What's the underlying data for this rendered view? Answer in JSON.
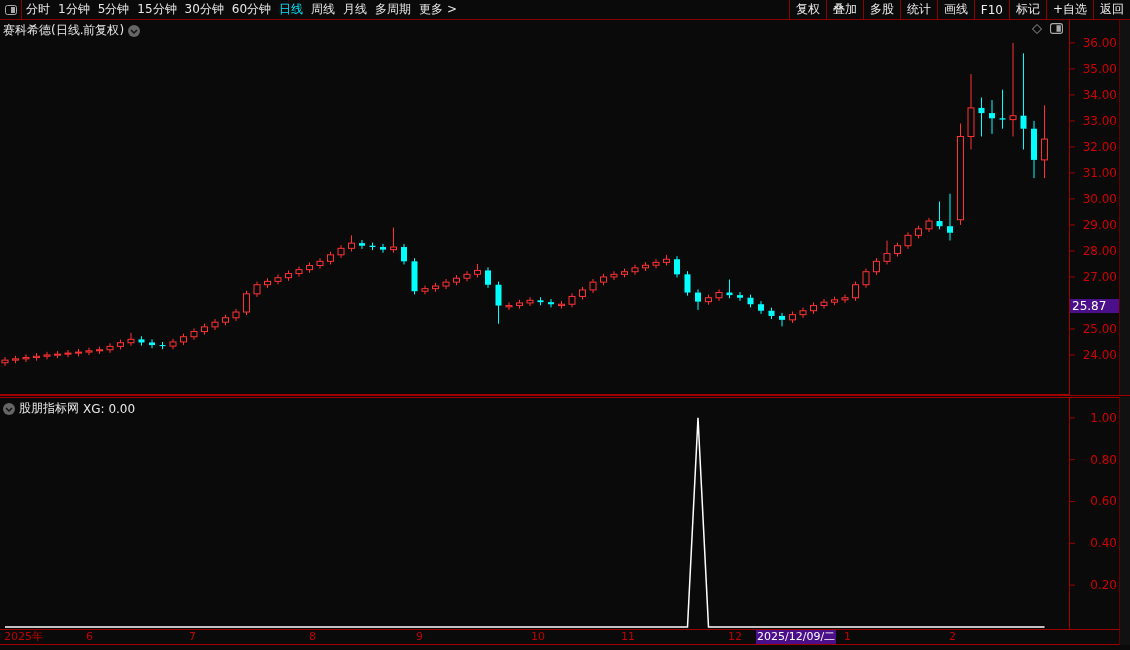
{
  "toolbar": {
    "periods": [
      {
        "label": "分时",
        "selected": false
      },
      {
        "label": "1分钟",
        "selected": false
      },
      {
        "label": "5分钟",
        "selected": false
      },
      {
        "label": "15分钟",
        "selected": false
      },
      {
        "label": "30分钟",
        "selected": false
      },
      {
        "label": "60分钟",
        "selected": false
      },
      {
        "label": "日线",
        "selected": true
      },
      {
        "label": "周线",
        "selected": false
      },
      {
        "label": "月线",
        "selected": false
      },
      {
        "label": "多周期",
        "selected": false
      }
    ],
    "more": "更多 >",
    "actions": [
      "复权",
      "叠加",
      "多股",
      "统计",
      "画线",
      "F10",
      "标记",
      "+自选",
      "返回"
    ]
  },
  "price_chart": {
    "title": "赛科希德(日线.前复权)",
    "last_price": "25.87",
    "chart_data": {
      "type": "candlestick",
      "ylim": [
        22.46,
        36.88
      ],
      "yticks": [
        {
          "value": 36,
          "label": "36.00"
        },
        {
          "value": 35,
          "label": "35.00"
        },
        {
          "value": 34,
          "label": "34.00"
        },
        {
          "value": 33,
          "label": "33.00"
        },
        {
          "value": 32,
          "label": "32.00"
        },
        {
          "value": 31,
          "label": "31.00"
        },
        {
          "value": 30,
          "label": "30.00"
        },
        {
          "value": 29,
          "label": "29.00"
        },
        {
          "value": 28,
          "label": "28.00"
        },
        {
          "value": 27,
          "label": "27.00"
        },
        {
          "value": 25,
          "label": "25.00"
        },
        {
          "value": 24,
          "label": "24.00"
        }
      ],
      "ohlc": [
        [
          23.7,
          23.92,
          23.58,
          23.8
        ],
        [
          23.8,
          23.97,
          23.68,
          23.85
        ],
        [
          23.85,
          24.02,
          23.73,
          23.9
        ],
        [
          23.9,
          24.07,
          23.78,
          23.95
        ],
        [
          23.95,
          24.12,
          23.83,
          24.0
        ],
        [
          24.0,
          24.15,
          23.88,
          24.03
        ],
        [
          24.03,
          24.19,
          23.91,
          24.07
        ],
        [
          24.07,
          24.23,
          23.95,
          24.11
        ],
        [
          24.11,
          24.28,
          23.99,
          24.16
        ],
        [
          24.16,
          24.32,
          24.04,
          24.2
        ],
        [
          24.2,
          24.45,
          24.08,
          24.33
        ],
        [
          24.33,
          24.59,
          24.21,
          24.47
        ],
        [
          24.47,
          24.85,
          24.35,
          24.6
        ],
        [
          24.6,
          24.72,
          24.36,
          24.48
        ],
        [
          24.48,
          24.6,
          24.26,
          24.38
        ],
        [
          24.38,
          24.5,
          24.22,
          24.34
        ],
        [
          24.34,
          24.62,
          24.22,
          24.5
        ],
        [
          24.5,
          24.82,
          24.38,
          24.7
        ],
        [
          24.7,
          25.02,
          24.58,
          24.9
        ],
        [
          24.9,
          25.2,
          24.78,
          25.08
        ],
        [
          25.08,
          25.38,
          24.96,
          25.26
        ],
        [
          25.26,
          25.55,
          25.14,
          25.43
        ],
        [
          25.43,
          25.77,
          25.31,
          25.65
        ],
        [
          25.65,
          26.47,
          25.53,
          26.35
        ],
        [
          26.35,
          26.82,
          26.23,
          26.7
        ],
        [
          26.7,
          26.95,
          26.58,
          26.83
        ],
        [
          26.83,
          27.09,
          26.71,
          26.97
        ],
        [
          26.97,
          27.25,
          26.85,
          27.13
        ],
        [
          27.13,
          27.4,
          27.01,
          27.28
        ],
        [
          27.28,
          27.56,
          27.16,
          27.44
        ],
        [
          27.44,
          27.72,
          27.32,
          27.6
        ],
        [
          27.6,
          27.97,
          27.48,
          27.85
        ],
        [
          27.85,
          28.22,
          27.73,
          28.1
        ],
        [
          28.1,
          28.6,
          27.98,
          28.3
        ],
        [
          28.3,
          28.42,
          28.08,
          28.2
        ],
        [
          28.2,
          28.32,
          28.03,
          28.15
        ],
        [
          28.15,
          28.27,
          27.93,
          28.05
        ],
        [
          28.05,
          28.9,
          27.93,
          28.15
        ],
        [
          28.15,
          28.27,
          27.48,
          27.6
        ],
        [
          27.6,
          27.72,
          26.33,
          26.45
        ],
        [
          26.45,
          26.67,
          26.33,
          26.55
        ],
        [
          26.55,
          26.77,
          26.43,
          26.65
        ],
        [
          26.65,
          26.92,
          26.53,
          26.8
        ],
        [
          26.8,
          27.07,
          26.68,
          26.95
        ],
        [
          26.95,
          27.22,
          26.83,
          27.1
        ],
        [
          27.1,
          27.5,
          26.98,
          27.25
        ],
        [
          27.25,
          27.37,
          26.58,
          26.7
        ],
        [
          26.7,
          26.82,
          25.2,
          25.9
        ],
        [
          25.85,
          26.02,
          25.73,
          25.9
        ],
        [
          25.9,
          26.12,
          25.78,
          26.0
        ],
        [
          26.0,
          26.22,
          25.88,
          26.1
        ],
        [
          26.1,
          26.22,
          25.91,
          26.03
        ],
        [
          26.03,
          26.15,
          25.83,
          25.95
        ],
        [
          25.9,
          26.07,
          25.78,
          25.95
        ],
        [
          25.95,
          26.37,
          25.83,
          26.25
        ],
        [
          26.25,
          26.62,
          26.13,
          26.5
        ],
        [
          26.5,
          26.92,
          26.38,
          26.8
        ],
        [
          26.8,
          27.12,
          26.68,
          27.0
        ],
        [
          27.0,
          27.22,
          26.88,
          27.1
        ],
        [
          27.1,
          27.32,
          26.98,
          27.2
        ],
        [
          27.2,
          27.47,
          27.08,
          27.35
        ],
        [
          27.35,
          27.57,
          27.23,
          27.45
        ],
        [
          27.45,
          27.68,
          27.33,
          27.56
        ],
        [
          27.56,
          27.85,
          27.44,
          27.68
        ],
        [
          27.68,
          27.8,
          26.98,
          27.1
        ],
        [
          27.1,
          27.22,
          26.28,
          26.4
        ],
        [
          26.4,
          26.52,
          25.73,
          26.05
        ],
        [
          26.05,
          26.32,
          25.93,
          26.2
        ],
        [
          26.2,
          26.52,
          26.08,
          26.4
        ],
        [
          26.4,
          26.9,
          26.18,
          26.3
        ],
        [
          26.3,
          26.42,
          26.08,
          26.2
        ],
        [
          26.2,
          26.32,
          25.83,
          25.95
        ],
        [
          25.95,
          26.07,
          25.58,
          25.7
        ],
        [
          25.7,
          25.82,
          25.38,
          25.5
        ],
        [
          25.5,
          25.62,
          25.1,
          25.35
        ],
        [
          25.35,
          25.67,
          25.23,
          25.55
        ],
        [
          25.55,
          25.82,
          25.43,
          25.7
        ],
        [
          25.7,
          26.02,
          25.58,
          25.9
        ],
        [
          25.9,
          26.15,
          25.78,
          26.03
        ],
        [
          26.03,
          26.24,
          25.91,
          26.12
        ],
        [
          26.12,
          26.32,
          26.0,
          26.2
        ],
        [
          26.2,
          26.82,
          26.08,
          26.7
        ],
        [
          26.7,
          27.32,
          26.58,
          27.2
        ],
        [
          27.2,
          27.72,
          27.08,
          27.6
        ],
        [
          27.6,
          28.4,
          27.48,
          27.9
        ],
        [
          27.9,
          28.32,
          27.78,
          28.2
        ],
        [
          28.2,
          28.72,
          28.08,
          28.6
        ],
        [
          28.6,
          28.97,
          28.48,
          28.85
        ],
        [
          28.85,
          29.27,
          28.73,
          29.15
        ],
        [
          29.15,
          29.9,
          28.83,
          28.95
        ],
        [
          28.95,
          30.2,
          28.4,
          28.7
        ],
        [
          29.2,
          32.9,
          29.0,
          32.4
        ],
        [
          32.4,
          34.8,
          31.9,
          33.5
        ],
        [
          33.5,
          33.9,
          32.4,
          33.3
        ],
        [
          33.3,
          33.8,
          32.5,
          33.1
        ],
        [
          33.1,
          34.2,
          32.7,
          33.05
        ],
        [
          33.05,
          36.0,
          32.4,
          33.2
        ],
        [
          33.2,
          35.6,
          31.9,
          32.7
        ],
        [
          32.7,
          33.0,
          30.8,
          31.5
        ],
        [
          31.5,
          33.6,
          30.8,
          32.3
        ]
      ]
    }
  },
  "indicator": {
    "title": "股朋指标网",
    "reading": "XG: 0.00",
    "chart_data": {
      "type": "line",
      "ylim": [
        -0.01,
        1.095
      ],
      "yticks": [
        {
          "value": 1,
          "label": "1.00"
        },
        {
          "value": 0.8,
          "label": "0.80"
        },
        {
          "value": 0.6,
          "label": "0.60"
        },
        {
          "value": 0.4,
          "label": "0.40"
        },
        {
          "value": 0.2,
          "label": "0.20"
        }
      ],
      "series": [
        {
          "color": "#ffffff",
          "values": [
            0,
            0,
            0,
            0,
            0,
            0,
            0,
            0,
            0,
            0,
            0,
            0,
            0,
            0,
            0,
            0,
            0,
            0,
            0,
            0,
            0,
            0,
            0,
            0,
            0,
            0,
            0,
            0,
            0,
            0,
            0,
            0,
            0,
            0,
            0,
            0,
            0,
            0,
            0,
            0,
            0,
            0,
            0,
            0,
            0,
            0,
            0,
            0,
            0,
            0,
            0,
            0,
            0,
            0,
            0,
            0,
            0,
            0,
            0,
            0,
            0,
            0,
            0,
            0,
            0,
            0,
            1,
            0,
            0,
            0,
            0,
            0,
            0,
            0,
            0,
            0,
            0,
            0,
            0,
            0,
            0,
            0,
            0,
            0,
            0,
            0,
            0,
            0,
            0,
            0,
            0,
            0,
            0,
            0,
            0,
            0,
            0,
            0,
            0,
            0
          ]
        }
      ]
    }
  },
  "time_axis": [
    {
      "label": "2025年",
      "selected": false
    },
    {
      "label": "6",
      "selected": false
    },
    {
      "label": "7",
      "selected": false
    },
    {
      "label": "8",
      "selected": false
    },
    {
      "label": "9",
      "selected": false
    },
    {
      "label": "10",
      "selected": false
    },
    {
      "label": "11",
      "selected": false
    },
    {
      "label": "12",
      "selected": false
    },
    {
      "label": "2025/12/09/二",
      "selected": true
    },
    {
      "label": "1",
      "selected": false
    },
    {
      "label": "2",
      "selected": false
    }
  ]
}
